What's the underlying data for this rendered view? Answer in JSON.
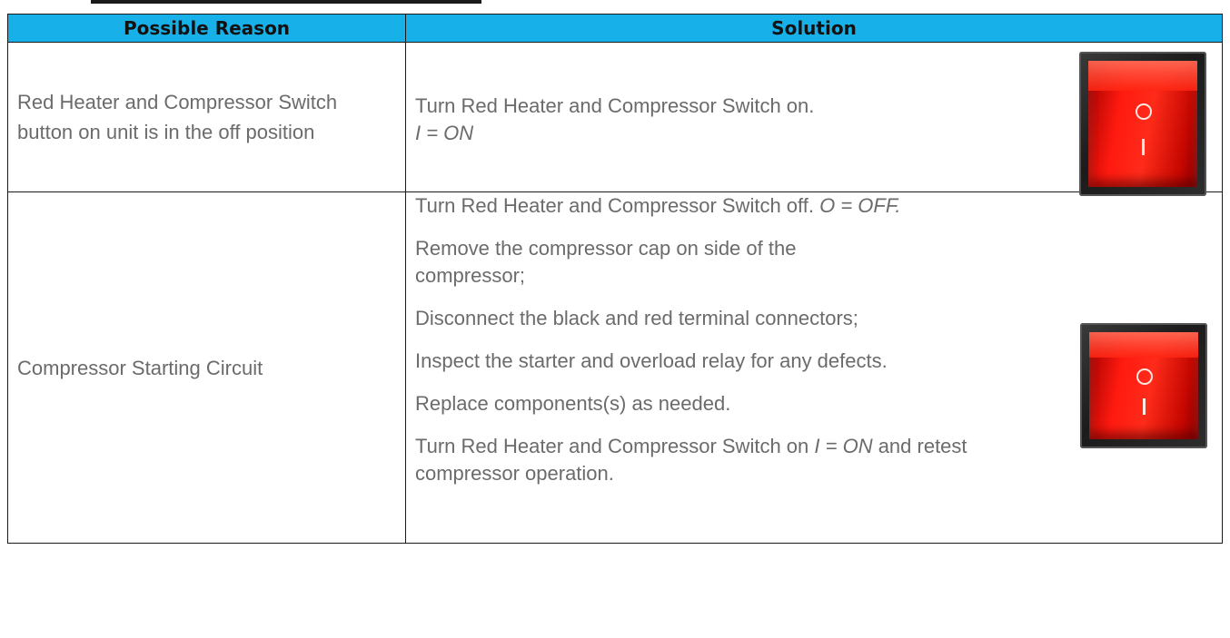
{
  "table": {
    "headers": [
      "Possible Reason",
      "Solution"
    ],
    "rows": [
      {
        "reason": "Red Heater and Compressor Switch button on unit is in the off position",
        "solution": [
          {
            "text": "Turn Red Heater and Compressor Switch on.",
            "em": ""
          },
          {
            "text": "",
            "em": "I = ON"
          }
        ],
        "image": {
          "icon": "rocker-switch-icon",
          "color": "#ff1a0f"
        }
      },
      {
        "reason": "Compressor Starting Circuit",
        "solution": [
          {
            "text": "Turn Red Heater and Compressor Switch off.  ",
            "em": "O = OFF."
          },
          {
            "text": "Remove the compressor cap on side of the",
            "em": ""
          },
          {
            "text": "compressor;",
            "em": ""
          },
          {
            "text": "Disconnect the black and red terminal connectors;",
            "em": ""
          },
          {
            "text": "Inspect the starter and overload relay for any defects.",
            "em": ""
          },
          {
            "text": "Replace components(s) as needed.",
            "em": ""
          },
          {
            "text": "Turn Red Heater and Compressor Switch on ",
            "em": "I = ON",
            "after": " and retest"
          },
          {
            "text": "compressor operation.",
            "em": ""
          }
        ],
        "image": {
          "icon": "rocker-switch-icon",
          "color": "#ff1a0f"
        }
      }
    ],
    "header_color": "#17b0e8",
    "text_color": "#6b6b6b"
  }
}
